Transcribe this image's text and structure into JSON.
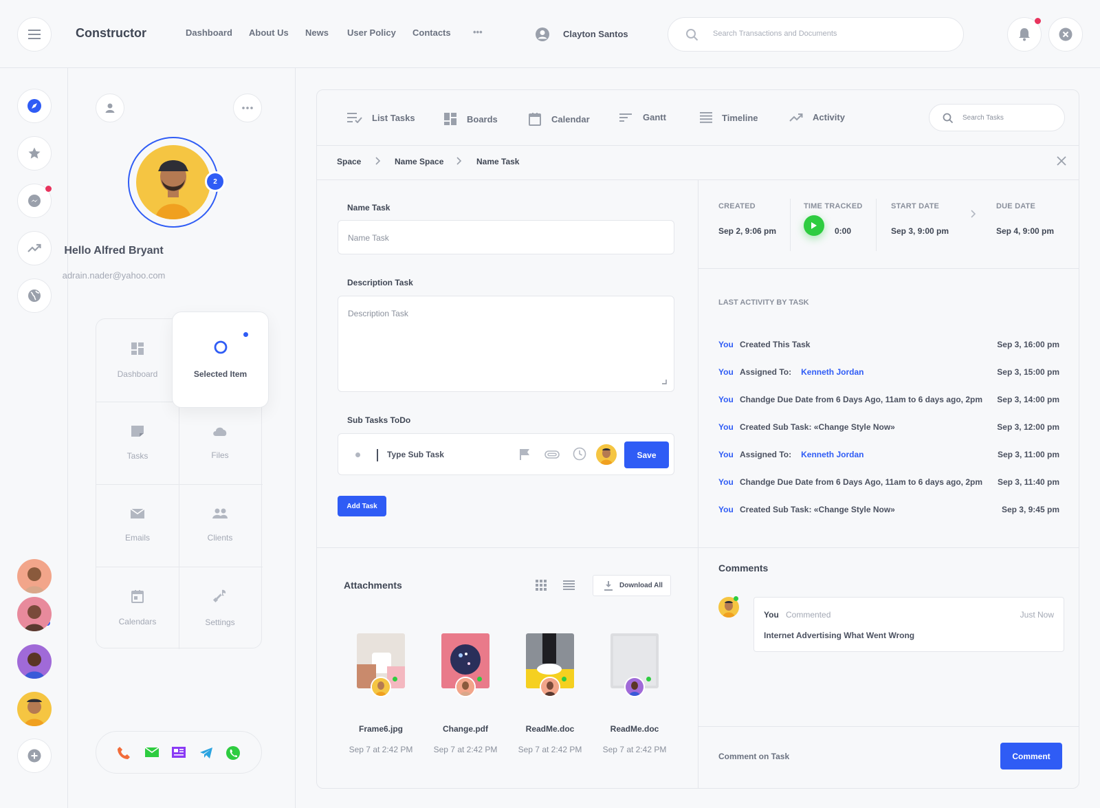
{
  "app": {
    "brand": "Constructor"
  },
  "top_nav": {
    "links": [
      "Dashboard",
      "About Us",
      "News",
      "User Policy",
      "Contacts"
    ],
    "more_label": "•••",
    "user_name": "Clayton Santos",
    "search_placeholder": "Search Transactions and Documents"
  },
  "profile": {
    "badge_count": "2",
    "greeting": "Hello Alfred Bryant",
    "email": "adrain.nader@yahoo.com",
    "grid_items": [
      "Dashboard",
      "Selected Item",
      "Tasks",
      "Files",
      "Emails",
      "Clients",
      "Calendars",
      "Settings"
    ]
  },
  "tabs": [
    "List Tasks",
    "Boards",
    "Calendar",
    "Gantt",
    "Timeline",
    "Activity"
  ],
  "task_search_placeholder": "Search Tasks",
  "breadcrumb": [
    "Space",
    "Name Space",
    "Name Task"
  ],
  "form": {
    "name_label": "Name Task",
    "name_placeholder": "Name Task",
    "description_label": "Description Task",
    "description_placeholder": "Description Task",
    "subtasks_label": "Sub Tasks ToDo",
    "subtask_placeholder": "Type Sub Task",
    "save_label": "Save",
    "add_task_label": "Add Task"
  },
  "meta": {
    "created_label": "CREATED",
    "created_value": "Sep 2, 9:06 pm",
    "tracked_label": "TIME TRACKED",
    "tracked_value": "0:00",
    "start_label": "START DATE",
    "start_value": "Sep 3, 9:00 pm",
    "due_label": "DUE DATE",
    "due_value": "Sep 4, 9:00 pm"
  },
  "activity": {
    "title": "LAST ACTIVITY BY TASK",
    "rows": [
      {
        "who": "You",
        "text": "Created This Task",
        "target": "",
        "time": "Sep 3, 16:00 pm"
      },
      {
        "who": "You",
        "text": "Assigned To:",
        "target": "Kenneth Jordan",
        "time": "Sep 3, 15:00 pm"
      },
      {
        "who": "You",
        "text": "Chandge Due Date from 6 Days Ago, 11am to 6 days ago, 2pm",
        "target": "",
        "time": "Sep 3, 14:00 pm"
      },
      {
        "who": "You",
        "text": "Created Sub Task: «Change Style Now»",
        "target": "",
        "time": "Sep 3, 12:00 pm"
      },
      {
        "who": "You",
        "text": "Assigned To:",
        "target": "Kenneth Jordan",
        "time": "Sep 3, 11:00 pm"
      },
      {
        "who": "You",
        "text": "Chandge Due Date from 6 Days Ago, 11am to 6 days ago, 2pm",
        "target": "",
        "time": "Sep 3, 11:40 pm"
      },
      {
        "who": "You",
        "text": "Created Sub Task: «Change Style Now»",
        "target": "",
        "time": "Sep 3, 9:45 pm"
      }
    ]
  },
  "attachments": {
    "title": "Attachments",
    "download_label": "Download All",
    "files": [
      {
        "name": "Frame6.jpg",
        "date": "Sep 7 at 2:42 PM"
      },
      {
        "name": "Change.pdf",
        "date": "Sep 7 at 2:42 PM"
      },
      {
        "name": "ReadMe.doc",
        "date": "Sep 7 at 2:42 PM"
      },
      {
        "name": "ReadMe.doc",
        "date": "Sep 7 at 2:42 PM"
      }
    ]
  },
  "comments": {
    "title": "Comments",
    "author": "You",
    "action": "Commented",
    "when": "Just Now",
    "text": "Internet Advertising What Went Wrong",
    "input_placeholder": "Comment on Task",
    "button_label": "Comment"
  },
  "colors": {
    "accent": "#2f5cf5",
    "alert": "#e8345d",
    "success": "#2ecc40"
  },
  "icons": [
    "menu-icon",
    "search-icon",
    "bell-icon",
    "close-circle-icon",
    "compass-icon",
    "star-icon",
    "messenger-icon",
    "trend-icon",
    "globe-icon",
    "plus-icon",
    "phone-icon",
    "mail-icon",
    "newspaper-icon",
    "telegram-icon",
    "whatsapp-icon"
  ]
}
